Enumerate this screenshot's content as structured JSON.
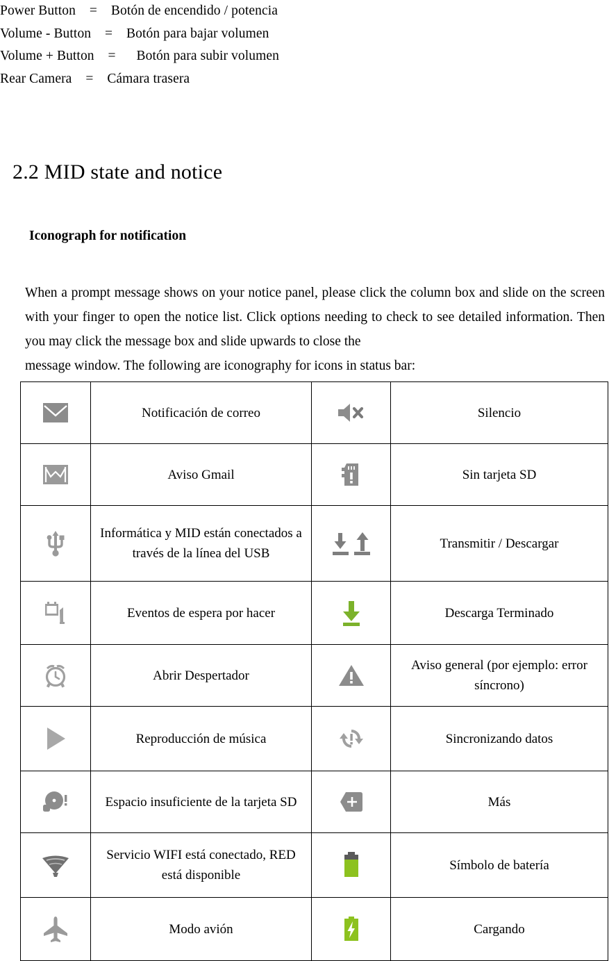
{
  "key_legend": [
    "Power Button    =    Botón de encendido / potencia",
    "Volume - Button    =    Botón para bajar volumen",
    "Volume + Button    =      Botón para subir volumen",
    "Rear Camera    =    Cámara trasera"
  ],
  "section": {
    "heading": "2.2 MID state and notice",
    "subheading": "Iconograph for notification",
    "paragraph": "When a prompt message shows on your notice panel, please click the column box and slide on the screen with your finger to open the notice list. Click options needing to check to see detailed information. Then you may click the message box and slide upwards to close the",
    "paragraph_last_line": "message window. The following are iconography for icons in status bar:"
  },
  "colors": {
    "icon_gray": "#8c8c8c",
    "icon_gray_dark": "#6e6e6e",
    "green": "#7cb22b",
    "green_bright": "#8dc21f",
    "battery_cap": "#5a5a5a",
    "table_border": "#000000"
  },
  "table": {
    "rows": [
      {
        "icon_left": "email-envelope-icon",
        "label_left": "Notificación de correo",
        "icon_right": "mute-speaker-icon",
        "label_right": "Silencio"
      },
      {
        "icon_left": "gmail-envelope-icon",
        "label_left": "Aviso Gmail",
        "icon_right": "no-sd-card-icon",
        "label_right": "Sin tarjeta SD"
      },
      {
        "icon_left": "usb-icon",
        "label_left": "Informática y MID están conectados a través de la línea del USB",
        "icon_right": "upload-download-icon",
        "label_right": "Transmitir / Descargar"
      },
      {
        "icon_left": "pending-event-icon",
        "label_left": "Eventos de espera por hacer",
        "icon_right": "download-complete-icon",
        "label_right": "Descarga Terminado"
      },
      {
        "icon_left": "alarm-clock-icon",
        "label_left": "Abrir Despertador",
        "icon_right": "warning-triangle-icon",
        "label_right": "Aviso general (por ejemplo: error síncrono)"
      },
      {
        "icon_left": "music-play-icon",
        "label_left": "Reproducción de música",
        "icon_right": "sync-data-icon",
        "label_right": "Sincronizando datos"
      },
      {
        "icon_left": "sd-card-low-space-icon",
        "label_left": "Espacio insuficiente de la tarjeta SD",
        "icon_right": "more-plus-icon",
        "label_right": "Más"
      },
      {
        "icon_left": "wifi-connected-icon",
        "label_left": "Servicio WIFI está conectado, RED está disponible",
        "icon_right": "battery-icon",
        "label_right": "Símbolo de batería"
      },
      {
        "icon_left": "airplane-mode-icon",
        "label_left": "Modo avión",
        "icon_right": "battery-charging-icon",
        "label_right": "Cargando"
      }
    ]
  }
}
